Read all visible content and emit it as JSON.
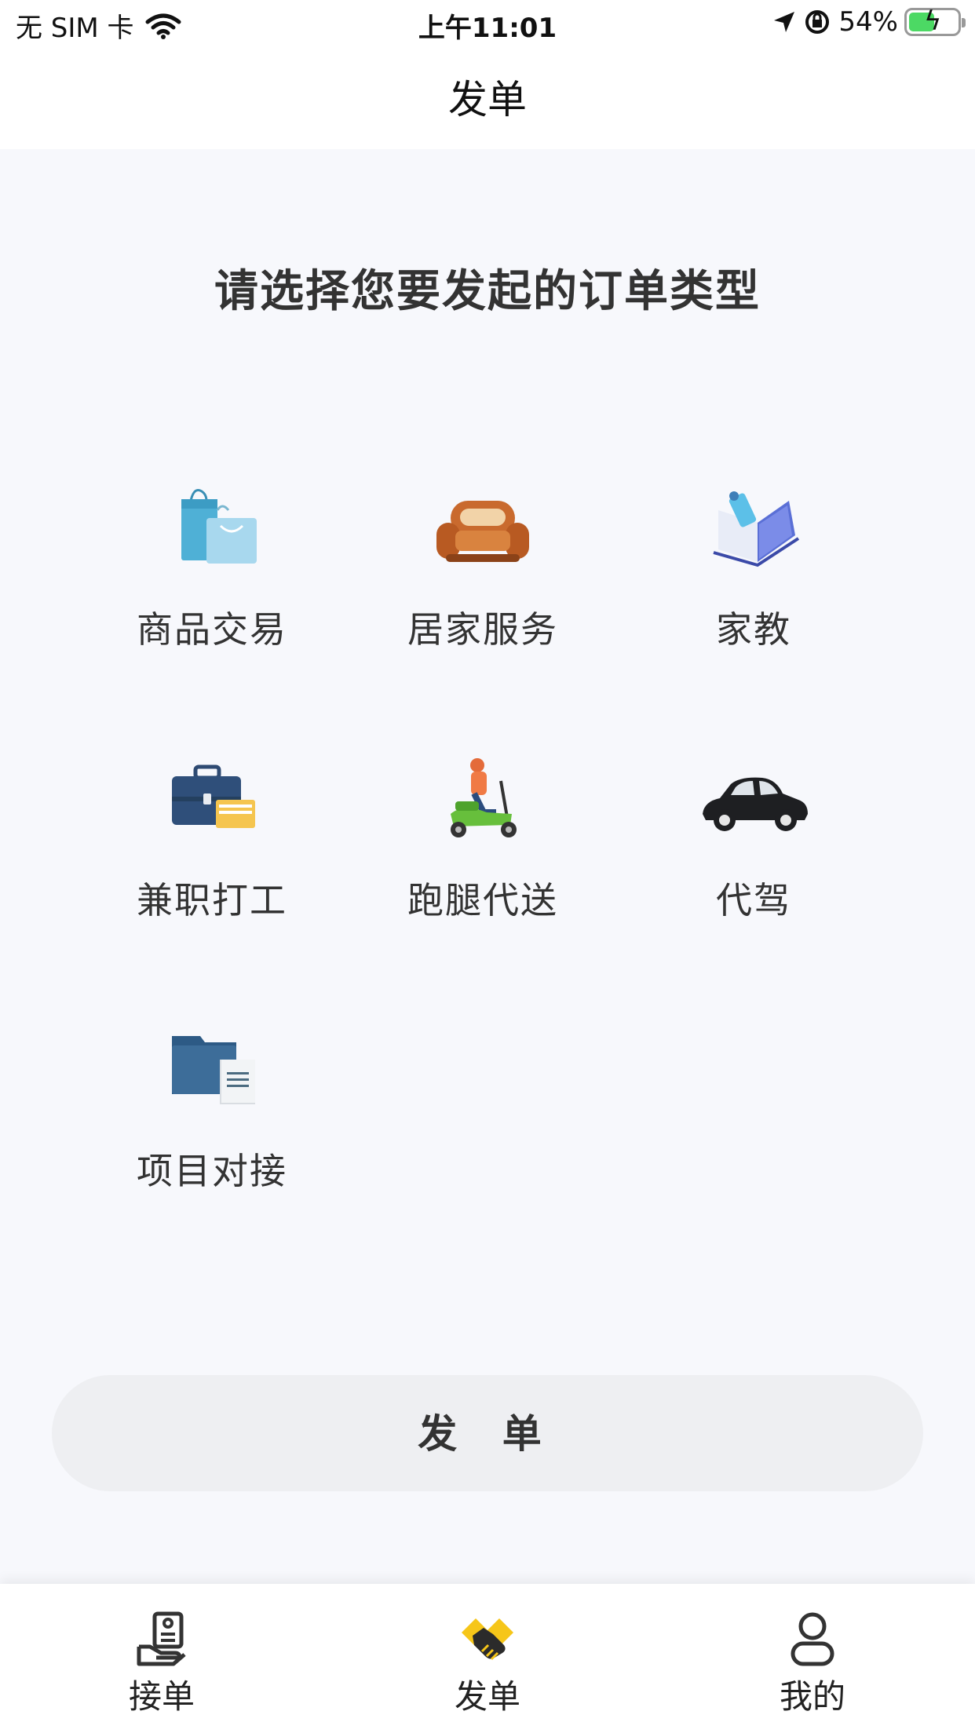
{
  "status_bar": {
    "carrier": "无 SIM 卡",
    "time": "上午11:01",
    "battery": "54%",
    "battery_level": 0.54
  },
  "nav": {
    "title": "发单"
  },
  "headline": "请选择您要发起的订单类型",
  "order_types": [
    {
      "label": "商品交易",
      "icon": "shopping-bag-icon"
    },
    {
      "label": "居家服务",
      "icon": "sofa-icon"
    },
    {
      "label": "家教",
      "icon": "tutor-book-icon"
    },
    {
      "label": "兼职打工",
      "icon": "briefcase-icon"
    },
    {
      "label": "跑腿代送",
      "icon": "scooter-delivery-icon"
    },
    {
      "label": "代驾",
      "icon": "car-icon"
    },
    {
      "label": "项目对接",
      "icon": "folder-document-icon"
    }
  ],
  "submit_button": {
    "label": "发 单"
  },
  "tabs": [
    {
      "label": "接单",
      "icon": "receive-order-icon",
      "active": false
    },
    {
      "label": "发单",
      "icon": "handshake-icon",
      "active": true
    },
    {
      "label": "我的",
      "icon": "profile-icon",
      "active": false
    }
  ],
  "colors": {
    "background": "#f7f8fc",
    "button_bg": "#eeeff2",
    "accent_yellow": "#f6c619",
    "battery_green": "#4cd964"
  }
}
